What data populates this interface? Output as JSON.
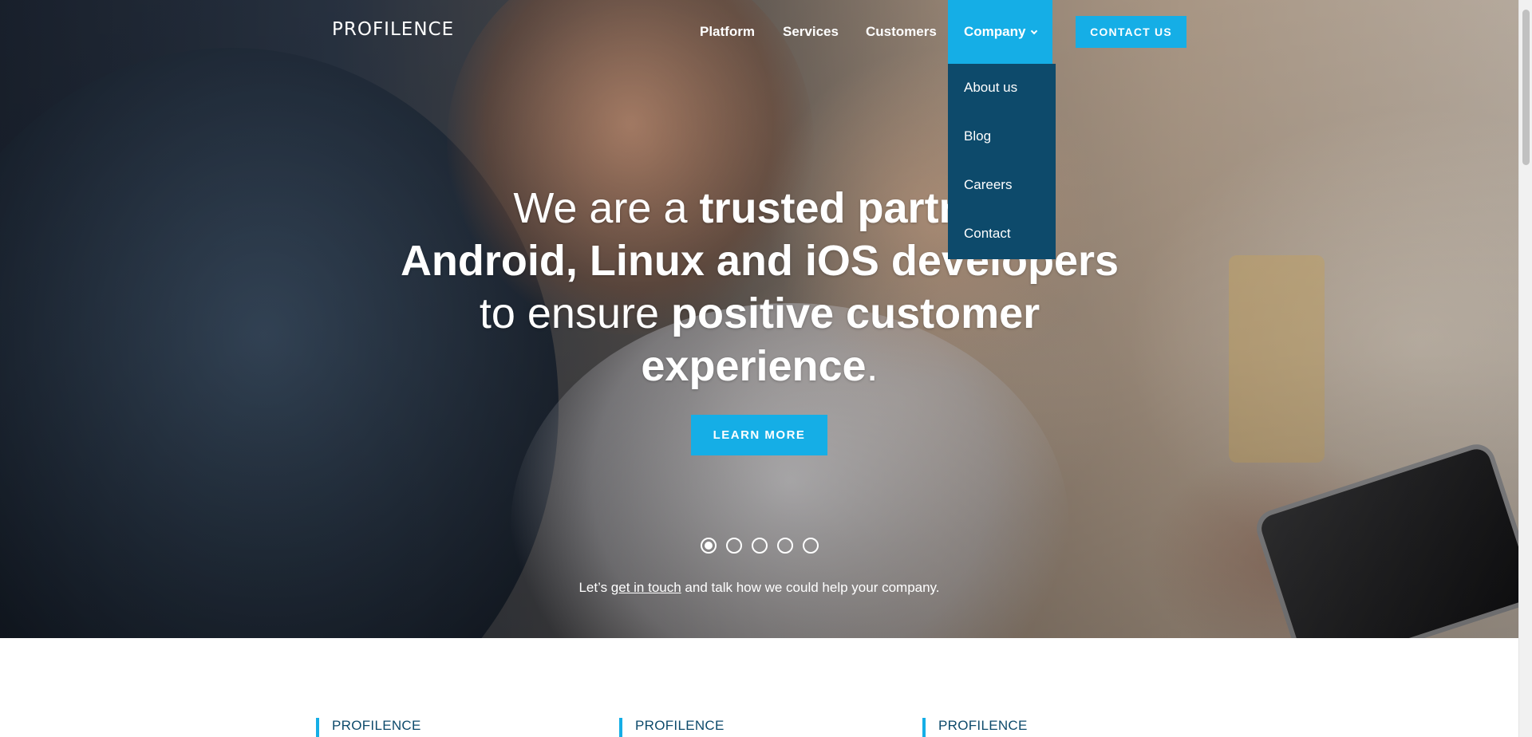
{
  "brand": {
    "logo_text": "PROFILENCE",
    "accent": "#15aee6",
    "dark_accent": "#0d4a6b"
  },
  "nav": {
    "items": [
      {
        "label": "Platform"
      },
      {
        "label": "Services"
      },
      {
        "label": "Customers"
      },
      {
        "label": "Company",
        "active": true,
        "icon": "chevron-down-icon"
      }
    ],
    "contact_label": "CONTACT US"
  },
  "dropdown": {
    "items": [
      {
        "label": "About us"
      },
      {
        "label": "Blog"
      },
      {
        "label": "Careers"
      },
      {
        "label": "Contact"
      }
    ]
  },
  "hero": {
    "line1_light": "We are a ",
    "line1_bold": "trusted partner",
    "line2_bold": "Android, Linux and iOS developers",
    "line3_light": "to ensure ",
    "line3_bold": "positive customer",
    "line4_bold": "experience",
    "line4_end": ".",
    "cta_label": "LEARN MORE",
    "slides_total": 5,
    "slide_active": 1,
    "tagline_before": "Let’s ",
    "tagline_link": "get in touch",
    "tagline_after": " and talk how we could help your company."
  },
  "features": [
    {
      "label": "PROFILENCE"
    },
    {
      "label": "PROFILENCE"
    },
    {
      "label": "PROFILENCE"
    }
  ]
}
